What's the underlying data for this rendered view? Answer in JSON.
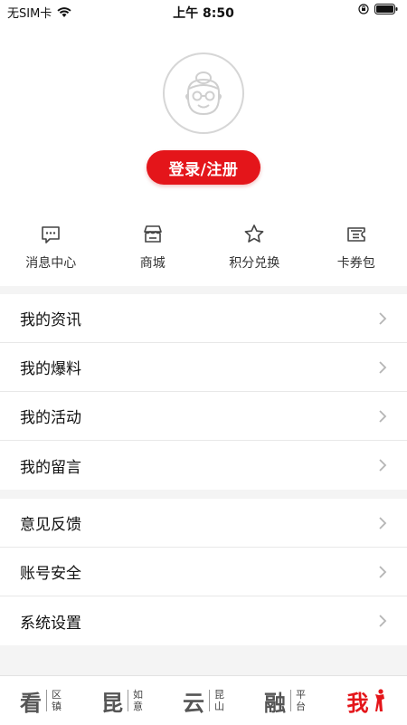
{
  "status_bar": {
    "carrier": "无SIM卡",
    "time": "上午 8:50"
  },
  "profile": {
    "avatar_icon": "default-avatar-icon",
    "login_label": "登录/注册"
  },
  "quick_links": [
    {
      "label": "消息中心",
      "icon": "message-icon"
    },
    {
      "label": "商城",
      "icon": "store-icon"
    },
    {
      "label": "积分兑换",
      "icon": "star-icon"
    },
    {
      "label": "卡券包",
      "icon": "ticket-icon"
    }
  ],
  "menu_group_1": [
    {
      "label": "我的资讯"
    },
    {
      "label": "我的爆料"
    },
    {
      "label": "我的活动"
    },
    {
      "label": "我的留言"
    }
  ],
  "menu_group_2": [
    {
      "label": "意见反馈"
    },
    {
      "label": "账号安全"
    },
    {
      "label": "系统设置"
    }
  ],
  "tab_bar": [
    {
      "big": "看",
      "small": [
        "区",
        "镇"
      ]
    },
    {
      "big": "昆",
      "small": [
        "如",
        "意"
      ]
    },
    {
      "big": "云",
      "small": [
        "昆",
        "山"
      ]
    },
    {
      "big": "融",
      "small": [
        "平",
        "台"
      ]
    },
    {
      "big": "我",
      "small": []
    }
  ],
  "colors": {
    "accent": "#e4151a",
    "background": "#f4f4f4"
  }
}
